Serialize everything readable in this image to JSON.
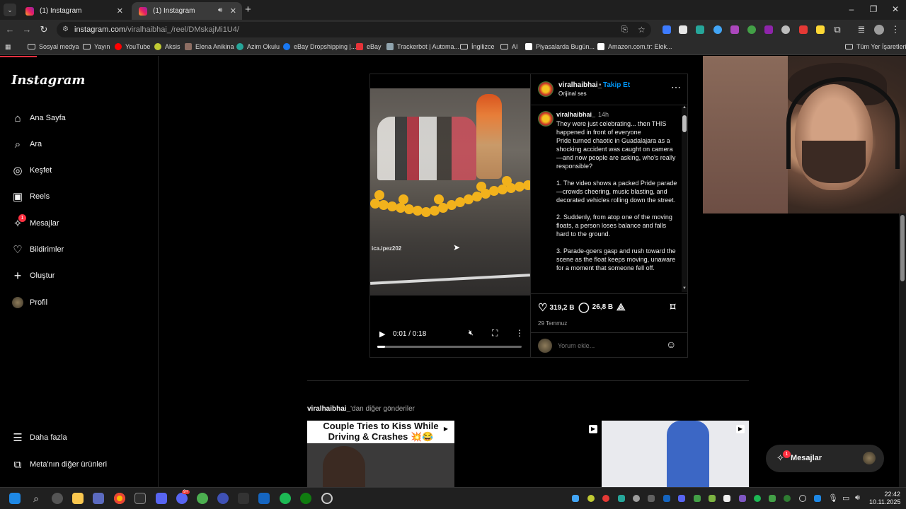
{
  "browser": {
    "tabs": [
      {
        "title": "(1) Instagram",
        "active": false
      },
      {
        "title": "(1) Instagram",
        "active": true,
        "audio": true
      }
    ],
    "url_host": "instagram.com",
    "url_path": "/viralhaibhai_/reel/DMskajMi1U4/",
    "bookmarks": [
      "Sosyal medya",
      "Yayın",
      "YouTube",
      "Aksis",
      "Elena Anikina",
      "Azim Okulu",
      "eBay Dropshipping |...",
      "eBay",
      "Trackerbot | Automa...",
      "İngilizce",
      "AI",
      "Piyasalarda Bugün...",
      "Amazon.com.tr: Elek..."
    ],
    "all_bookmarks": "Tüm Yer İşaretleri"
  },
  "sidebar": {
    "logo": "Instagram",
    "items": [
      {
        "label": "Ana Sayfa",
        "icon": "home-icon"
      },
      {
        "label": "Ara",
        "icon": "search-icon"
      },
      {
        "label": "Keşfet",
        "icon": "compass-icon"
      },
      {
        "label": "Reels",
        "icon": "reels-icon"
      },
      {
        "label": "Mesajlar",
        "icon": "messenger-icon",
        "badge": "1"
      },
      {
        "label": "Bildirimler",
        "icon": "heart-icon"
      },
      {
        "label": "Oluştur",
        "icon": "plus-icon"
      },
      {
        "label": "Profil",
        "icon": "avatar-icon"
      }
    ],
    "more": "Daha fazla",
    "meta": "Meta'nın diğer ürünleri"
  },
  "post": {
    "username": "viralhaibhai_",
    "follow": "Takip Et",
    "audio": "Orijinal ses",
    "caption_user": "viralhaibhai_",
    "caption_time": "14h",
    "caption": "They were just celebrating... then THIS happened in front of everyone\nPride turned chaotic in Guadalajara as a shocking accident was caught on camera—and now people are asking, who's really responsible?\n\n1. The video shows a packed Pride parade—crowds cheering, music blasting, and decorated vehicles rolling down the street.\n\n2. Suddenly, from atop one of the moving floats, a person loses balance and falls hard to the ground.\n\n3. Parade-goers gasp and rush toward the scene as the float keeps moving, unaware for a moment that someone fell off.",
    "likes": "319,2 B",
    "comments": "26,8 B",
    "date": "29 Temmuz",
    "comment_placeholder": "Yorum ekle...",
    "video_time": "0:01 / 0:18",
    "video_progress": 0.0556,
    "watermark": "ica.ipez202"
  },
  "more_posts": {
    "user": "viralhaibhai_",
    "suffix": "'dan diğer gönderiler",
    "thumb1_title": "Couple Tries to Kiss While Driving & Crashes 💥😂"
  },
  "messages_pill": {
    "label": "Mesajlar",
    "badge": "1"
  },
  "taskbar": {
    "time": "22:42",
    "date": "10.11.2025",
    "badge": "9+"
  },
  "colors": {
    "follow": "#0095f6",
    "badge": "#ff3040",
    "background": "#000000"
  }
}
